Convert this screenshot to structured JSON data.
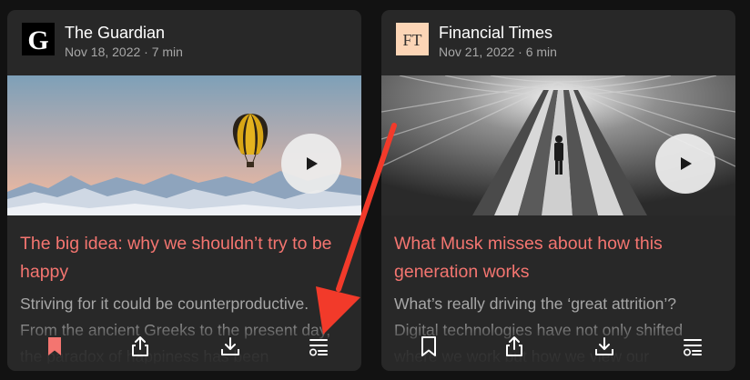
{
  "cards": [
    {
      "source": "The Guardian",
      "logo_text": "G",
      "meta": "Nov 18, 2022 · 7 min",
      "title": "The big idea: why we shouldn’t try to be happy",
      "description": "Striving for it could be counterproductive. From the ancient Greeks to the present day, the paradox of happiness has been",
      "bookmarked": true,
      "icons": [
        "bookmark-icon",
        "share-icon",
        "download-icon",
        "add-to-queue-icon"
      ]
    },
    {
      "source": "Financial Times",
      "logo_text": "FT",
      "meta": "Nov 21, 2022 · 6 min",
      "title": "What Musk misses about how this generation works",
      "description": "What’s really driving the ‘great attrition’? Digital technologies have not only shifted where we work but how we view our",
      "bookmarked": false,
      "icons": [
        "bookmark-icon",
        "share-icon",
        "download-icon",
        "add-to-queue-icon"
      ]
    }
  ],
  "colors": {
    "background": "#121212",
    "card": "#282828",
    "title": "#f47570",
    "secondary_text": "#a7a7a7",
    "bookmark_active": "#f47570",
    "annotation_arrow": "#f23a2a"
  }
}
